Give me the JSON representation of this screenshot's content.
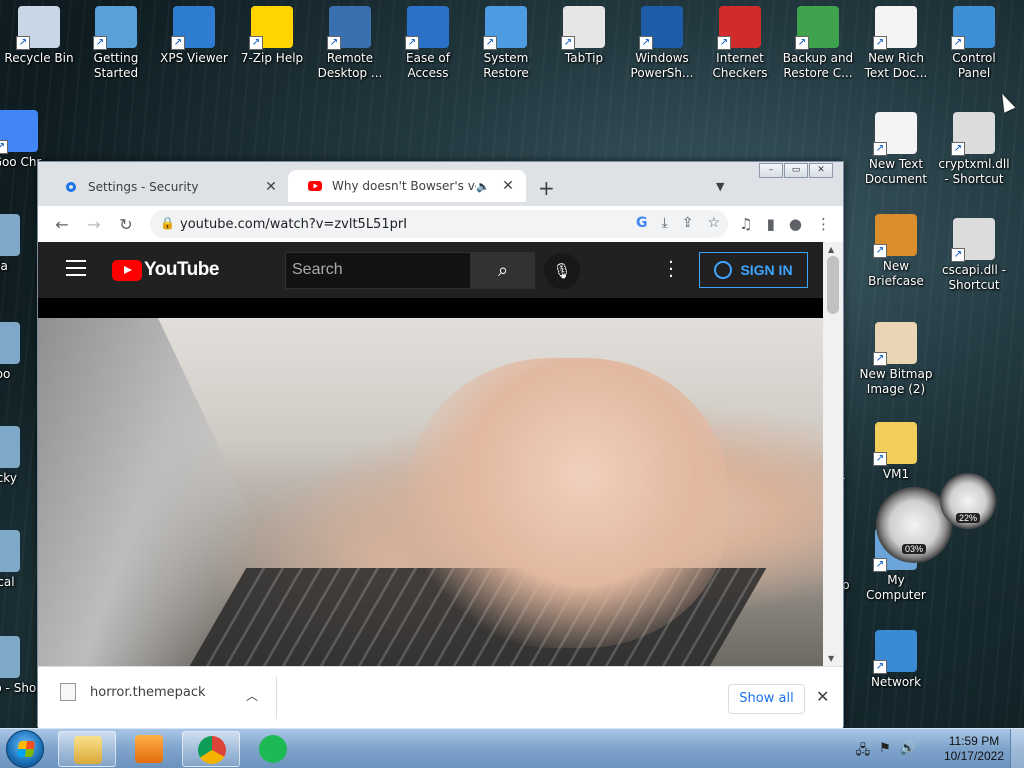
{
  "desktop": {
    "row1": [
      {
        "label": "Recycle Bin",
        "icon": "recycle-bin-icon",
        "color": "#c9d6e6"
      },
      {
        "label": "Getting Started",
        "icon": "getting-started-icon",
        "color": "#5aa0d8"
      },
      {
        "label": "XPS Viewer",
        "icon": "xps-viewer-icon",
        "color": "#2e7dd1"
      },
      {
        "label": "7-Zip Help",
        "icon": "help-icon",
        "color": "#ffd400"
      },
      {
        "label": "Remote Desktop ...",
        "icon": "remote-desktop-icon",
        "color": "#3a6fb0"
      },
      {
        "label": "Ease of Access",
        "icon": "ease-of-access-icon",
        "color": "#2a72c9"
      },
      {
        "label": "System Restore",
        "icon": "system-restore-icon",
        "color": "#4d9be0"
      },
      {
        "label": "TabTip",
        "icon": "tabtip-icon",
        "color": "#e6e6e6"
      },
      {
        "label": "Windows PowerSh...",
        "icon": "powershell-icon",
        "color": "#1d5da8"
      },
      {
        "label": "Internet Checkers",
        "icon": "checkers-icon",
        "color": "#d12b2b"
      },
      {
        "label": "Backup and Restore C...",
        "icon": "backup-icon",
        "color": "#3fa34d"
      },
      {
        "label": "New Rich Text Doc...",
        "icon": "rtf-icon",
        "color": "#f4f4f4"
      },
      {
        "label": "Control Panel",
        "icon": "control-panel-icon",
        "color": "#3f8fd6"
      }
    ],
    "row2": [
      {
        "label": "Goo Chr",
        "icon": "chrome-icon",
        "color": "#4285f4"
      },
      {
        "label": "New Text Document",
        "icon": "text-document-icon",
        "color": "#f4f4f4"
      },
      {
        "label": "cryptxml.dll - Shortcut",
        "icon": "dll-shortcut-icon",
        "color": "#dcdcdc"
      }
    ],
    "left_partial": [
      {
        "label": "Ma",
        "icon": "app-icon"
      },
      {
        "label": "Spo",
        "icon": "spotify-icon"
      },
      {
        "label": "Sticky",
        "icon": "sticky-notes-icon"
      },
      {
        "label": "Local",
        "icon": "local-icon"
      },
      {
        "label": "Contro - Sho",
        "icon": "control-panel-icon"
      }
    ],
    "right_column": [
      {
        "label": "New Briefcase",
        "icon": "briefcase-icon",
        "color": "#d98e2b"
      },
      {
        "label": "cscapi.dll - Shortcut",
        "icon": "dll-shortcut-icon",
        "color": "#dcdcdc"
      },
      {
        "label": "New Bitmap Image (2)",
        "icon": "bitmap-icon",
        "color": "#e8d6b5"
      },
      {
        "label": "VM1",
        "icon": "folder-icon",
        "color": "#f2cf5b"
      },
      {
        "label": "My Computer",
        "icon": "computer-icon",
        "color": "#6aa4d8"
      },
      {
        "label": "Network",
        "icon": "network-icon",
        "color": "#3a8ad6"
      }
    ],
    "partial_labels": {
      "sc": "sc",
      "r": "r",
      "p": "p"
    },
    "gadget": {
      "cpu": "03%",
      "mem": "22%"
    }
  },
  "browser": {
    "tabs": [
      {
        "title": "Settings - Security",
        "icon": "settings-gear-icon",
        "active": false
      },
      {
        "title": "Why doesn't Bowser's voice",
        "icon": "youtube-icon",
        "active": true
      }
    ],
    "new_tab": "+",
    "url": "youtube.com/watch?v=zvlt5L51prI",
    "page": {
      "logo": "YouTube",
      "search_placeholder": "Search",
      "sign_in": "SIGN IN"
    },
    "download": {
      "file": "horror.themepack",
      "show_all": "Show all"
    }
  },
  "taskbar": {
    "time": "11:59 PM",
    "date": "10/17/2022"
  },
  "colors": {
    "youtube_red": "#ff0000",
    "signin_blue": "#3ea6ff",
    "chrome_blue": "#1a73e8"
  }
}
